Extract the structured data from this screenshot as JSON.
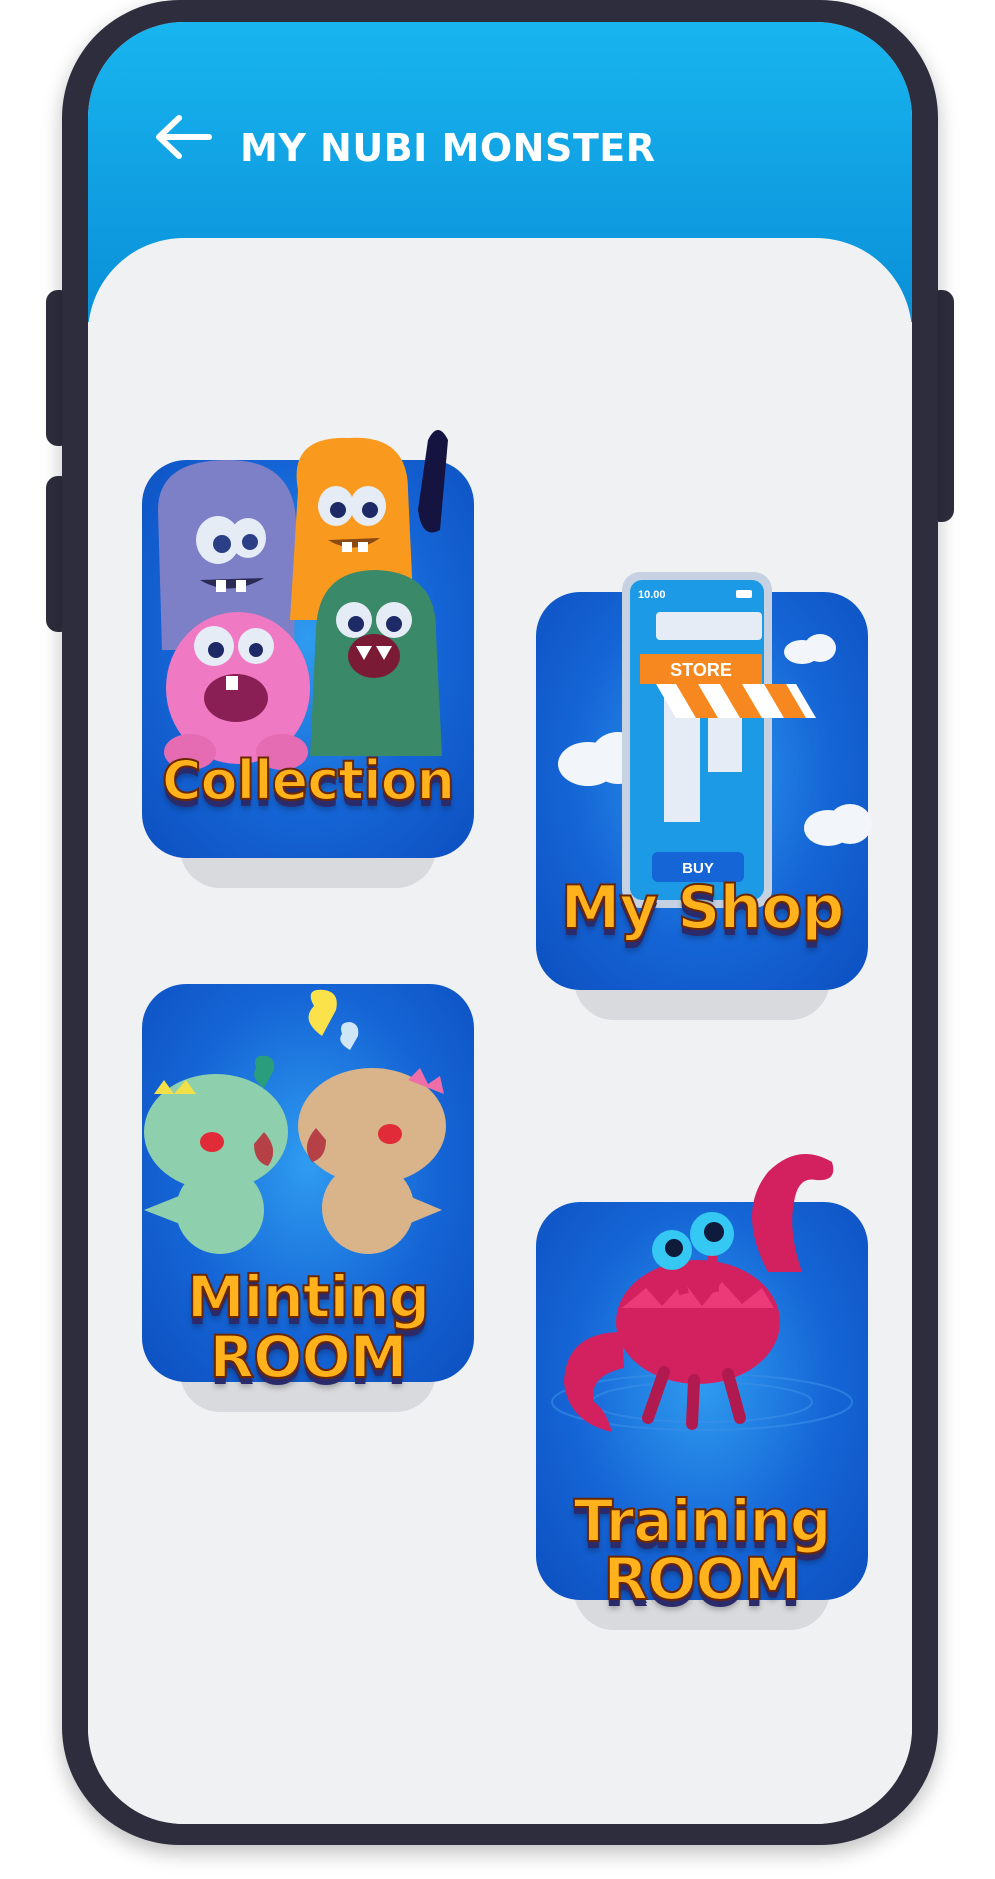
{
  "header": {
    "title": "MY NUBI MONSTER",
    "back_icon": "arrow-left-icon"
  },
  "tiles": [
    {
      "label_line1": "Collection",
      "label_line2": "",
      "art": "monster-group"
    },
    {
      "label_line1": "My Shop",
      "label_line2": "",
      "art": "phone-store"
    },
    {
      "label_line1": "Minting",
      "label_line2": "ROOM",
      "art": "dinosaurs-in-love"
    },
    {
      "label_line1": "Training",
      "label_line2": "ROOM",
      "art": "red-crab"
    }
  ],
  "shop_art": {
    "phone_time": "10.00",
    "store_sign": "STORE",
    "buy_button": "BUY"
  },
  "colors": {
    "header_top": "#18b5ef",
    "header_bottom": "#0a8fd8",
    "card_blue": "#1565d6",
    "label_orange": "#ffb21c",
    "device_frame": "#2d2d3d"
  }
}
